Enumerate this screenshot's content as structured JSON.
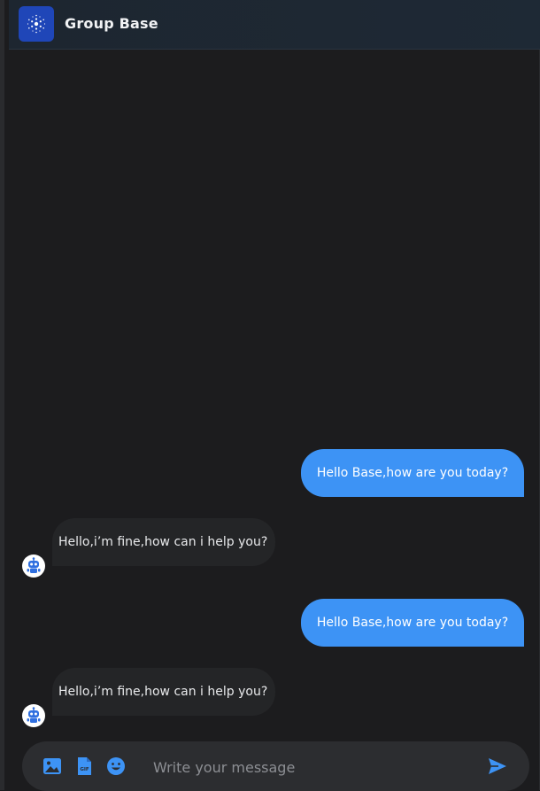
{
  "header": {
    "title": "Group Base",
    "logo_icon": "cardano-logo-icon"
  },
  "messages": [
    {
      "from": "user",
      "text": "Hello Base,how are you today?"
    },
    {
      "from": "bot",
      "text": "Hello,i’m fine,how can i help you?",
      "avatar_icon": "robot-icon"
    },
    {
      "from": "user",
      "text": "Hello Base,how are you today?"
    },
    {
      "from": "bot",
      "text": "Hello,i’m fine,how can i help you?",
      "avatar_icon": "robot-icon"
    }
  ],
  "composer": {
    "placeholder": "Write your message",
    "icons": [
      "image-icon",
      "gif-icon",
      "emoji-icon",
      "send-icon"
    ]
  },
  "colors": {
    "background": "#1c1c1e",
    "header": "#1e2935",
    "user_bubble": "#3d93f5",
    "bot_bubble": "#242527",
    "accent": "#3d93f5"
  }
}
